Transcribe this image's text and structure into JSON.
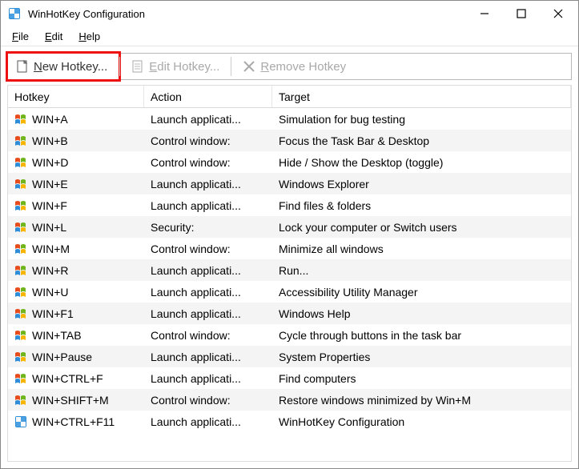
{
  "window": {
    "title": "WinHotKey Configuration"
  },
  "menubar": [
    {
      "label": "File",
      "mnemonic": "F"
    },
    {
      "label": "Edit",
      "mnemonic": "E"
    },
    {
      "label": "Help",
      "mnemonic": "H"
    }
  ],
  "toolbar": {
    "new_label": "New Hotkey...",
    "new_mnemonic": "N",
    "edit_label": "Edit Hotkey...",
    "edit_mnemonic": "E",
    "remove_label": "Remove Hotkey",
    "remove_mnemonic": "R"
  },
  "columns": {
    "hotkey": "Hotkey",
    "action": "Action",
    "target": "Target"
  },
  "rows": [
    {
      "icon": "winflag",
      "hotkey": "WIN+A",
      "action": "Launch applicati...",
      "target": "Simulation for bug testing"
    },
    {
      "icon": "winflag",
      "hotkey": "WIN+B",
      "action": "Control window:",
      "target": "Focus the Task Bar & Desktop"
    },
    {
      "icon": "winflag",
      "hotkey": "WIN+D",
      "action": "Control window:",
      "target": "Hide / Show the Desktop (toggle)"
    },
    {
      "icon": "winflag",
      "hotkey": "WIN+E",
      "action": "Launch applicati...",
      "target": "Windows Explorer"
    },
    {
      "icon": "winflag",
      "hotkey": "WIN+F",
      "action": "Launch applicati...",
      "target": "Find files & folders"
    },
    {
      "icon": "winflag",
      "hotkey": "WIN+L",
      "action": "Security:",
      "target": "Lock your computer or Switch users"
    },
    {
      "icon": "winflag",
      "hotkey": "WIN+M",
      "action": "Control window:",
      "target": "Minimize all windows"
    },
    {
      "icon": "winflag",
      "hotkey": "WIN+R",
      "action": "Launch applicati...",
      "target": "Run..."
    },
    {
      "icon": "winflag",
      "hotkey": "WIN+U",
      "action": "Launch applicati...",
      "target": "Accessibility Utility Manager"
    },
    {
      "icon": "winflag",
      "hotkey": "WIN+F1",
      "action": "Launch applicati...",
      "target": "Windows Help"
    },
    {
      "icon": "winflag",
      "hotkey": "WIN+TAB",
      "action": "Control window:",
      "target": "Cycle through buttons in the task bar"
    },
    {
      "icon": "winflag",
      "hotkey": "WIN+Pause",
      "action": "Launch applicati...",
      "target": "System Properties"
    },
    {
      "icon": "winflag",
      "hotkey": "WIN+CTRL+F",
      "action": "Launch applicati...",
      "target": "Find computers"
    },
    {
      "icon": "winflag",
      "hotkey": "WIN+SHIFT+M",
      "action": "Control window:",
      "target": "Restore windows minimized by Win+M"
    },
    {
      "icon": "appicon",
      "hotkey": "WIN+CTRL+F11",
      "action": "Launch applicati...",
      "target": "WinHotKey Configuration"
    }
  ]
}
